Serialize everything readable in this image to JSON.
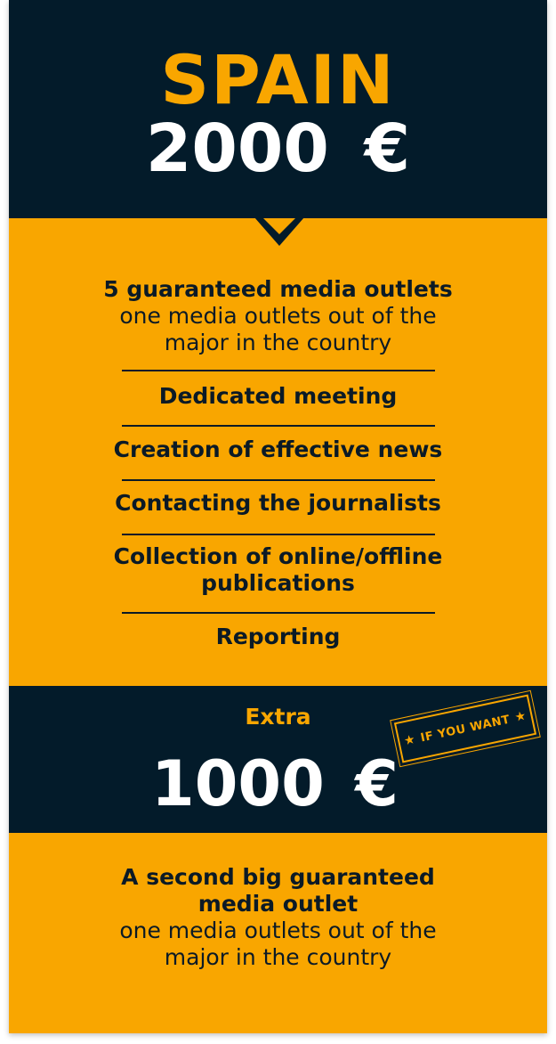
{
  "header": {
    "country": "SPAIN",
    "price": "2000 €"
  },
  "features": [
    {
      "title": "5 guaranteed media outlets",
      "subtitle": "one media outlets out of the major in the country"
    },
    {
      "title": "Dedicated meeting"
    },
    {
      "title": "Creation of effective news"
    },
    {
      "title": "Contacting the journalists"
    },
    {
      "title": "Collection of online/offline publications"
    },
    {
      "title": "Reporting"
    }
  ],
  "extra": {
    "label": "Extra",
    "price": "1000 €",
    "stamp": "IF YOU WANT"
  },
  "bottom": {
    "title": "A second big guaranteed media outlet",
    "subtitle": "one media outlets out of the major in the country"
  },
  "colors": {
    "navy": "#031b2a",
    "orange": "#f9a600",
    "text_dark": "#0b1a26",
    "white": "#ffffff"
  },
  "icons": [
    "star-icon"
  ]
}
